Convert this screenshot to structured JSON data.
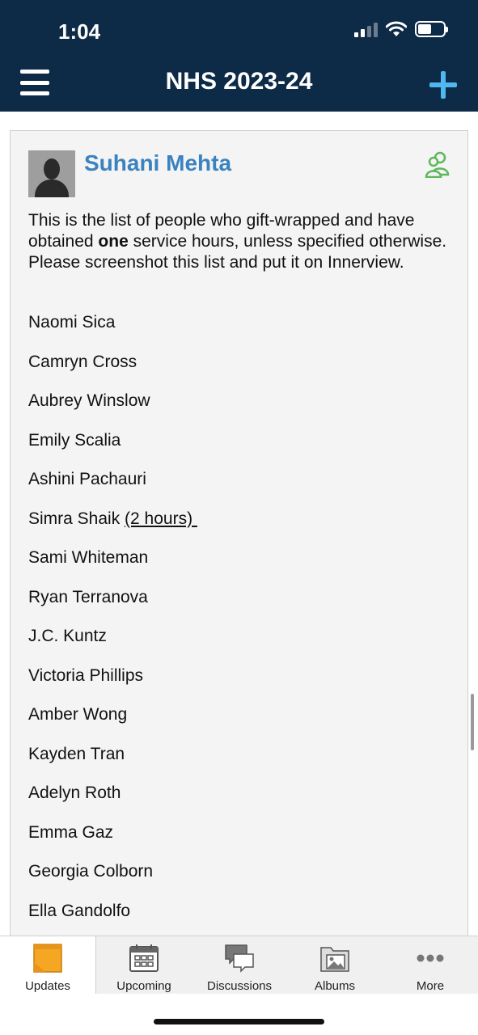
{
  "status_bar": {
    "time": "1:04"
  },
  "header": {
    "title": "NHS 2023-24"
  },
  "post": {
    "author": "Suhani Mehta",
    "intro_before": "This is the list of people who gift-wrapped and have obtained ",
    "intro_bold": "one",
    "intro_after": " service hours, unless specified otherwise. Please screenshot this list and put it on Innerview.",
    "names": [
      {
        "name": "Naomi Sica",
        "note": ""
      },
      {
        "name": "Camryn Cross",
        "note": ""
      },
      {
        "name": "Aubrey Winslow",
        "note": ""
      },
      {
        "name": "Emily Scalia",
        "note": ""
      },
      {
        "name": "Ashini Pachauri",
        "note": ""
      },
      {
        "name": "Simra Shaik ",
        "note": "(2 hours) "
      },
      {
        "name": "Sami Whiteman",
        "note": ""
      },
      {
        "name": "Ryan Terranova",
        "note": ""
      },
      {
        "name": "J.C. Kuntz",
        "note": ""
      },
      {
        "name": "Victoria Phillips",
        "note": ""
      },
      {
        "name": "Amber Wong",
        "note": ""
      },
      {
        "name": "Kayden Tran",
        "note": ""
      },
      {
        "name": "Adelyn Roth",
        "note": ""
      },
      {
        "name": "Emma Gaz",
        "note": ""
      },
      {
        "name": "Georgia Colborn",
        "note": ""
      },
      {
        "name": "Ella Gandolfo",
        "note": ""
      }
    ]
  },
  "tabs": [
    {
      "label": "Updates",
      "icon": "sticky-note-icon"
    },
    {
      "label": "Upcoming",
      "icon": "calendar-icon"
    },
    {
      "label": "Discussions",
      "icon": "chat-bubbles-icon"
    },
    {
      "label": "Albums",
      "icon": "photo-album-icon"
    },
    {
      "label": "More",
      "icon": "more-dots-icon"
    }
  ],
  "colors": {
    "header_bg": "#0d2a46",
    "accent_blue": "#3a83c0",
    "plus_blue": "#4fb8ee",
    "group_green": "#5cb85c",
    "updates_orange": "#f5a623"
  }
}
